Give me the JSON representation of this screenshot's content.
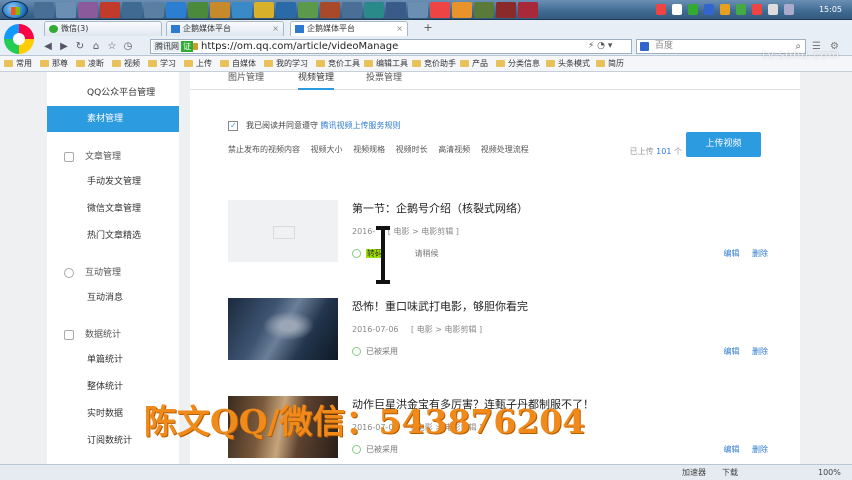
{
  "taskbar": {
    "tasks": [
      {
        "label": "微信(3)",
        "active": false
      },
      {
        "label": "企鹅媒体平台",
        "active": false
      },
      {
        "label": "企鹅媒体平台",
        "active": true
      }
    ],
    "clock": "15:05"
  },
  "browser": {
    "tabs": [
      {
        "label": "企鹅媒体平台"
      },
      {
        "label": "企鹅媒体平台"
      }
    ],
    "new_tab": "+",
    "address_badge": "腾讯网",
    "address_badge2": "证",
    "url": "https://om.qq.com/article/videoManage",
    "search_placeholder": "百度",
    "bookmarks": [
      "常用",
      "那尊",
      "凌断",
      "视频",
      "学习",
      "上传",
      "自媒体",
      "我的学习",
      "竞价工具",
      "编辑工具",
      "竞价助手",
      "产品",
      "分类信息",
      "头条模式",
      "简历"
    ],
    "watermark": "tv.sohu.com"
  },
  "sidebar": {
    "top_item": "QQ公众平台管理",
    "active_item": "素材管理",
    "sections": [
      {
        "title": "文章管理",
        "items": [
          "手动发文管理",
          "微信文章管理",
          "热门文章精选"
        ]
      },
      {
        "title": "互动管理",
        "items": [
          "互动消息"
        ]
      },
      {
        "title": "数据统计",
        "items": [
          "单篇统计",
          "整体统计",
          "实时数据",
          "订阅数统计"
        ]
      }
    ]
  },
  "main": {
    "tabs": [
      "图片管理",
      "视频管理",
      "投票管理"
    ],
    "agree_text": "我已阅读并同意遵守",
    "agree_link": "腾讯视频上传服务规则",
    "rules": [
      "禁止发布的视频内容",
      "视频大小",
      "视频规格",
      "视频时长",
      "高清视频",
      "视频处理流程"
    ],
    "uploaded_prefix": "已上传",
    "uploaded_count": "101",
    "uploaded_suffix": "个",
    "upload_button": "上传视频",
    "edit_label": "编辑",
    "delete_label": "删除",
    "videos": [
      {
        "title": "第一节：企鹅号介绍（核裂式网络）",
        "date": "2016-",
        "category": "[ 电影 > 电影剪辑 ]",
        "status_hl": "转码",
        "status_extra": "请稍候"
      },
      {
        "title": "恐怖！重口味武打电影，够胆你看完",
        "date": "2016-07-06",
        "category": "[ 电影 > 电影剪辑 ]",
        "status": "已被采用"
      },
      {
        "title": "动作巨星洪金宝有多厉害？连甄子丹都制服不了！",
        "date": "2016-07-06",
        "category": "[ 电影 > 电影剪辑 ]",
        "status": "已被采用"
      }
    ]
  },
  "overlay_text": "陈文QQ/微信：543876204",
  "statusbar": {
    "left": "加速器",
    "center": "下载",
    "zoom": "100%"
  }
}
